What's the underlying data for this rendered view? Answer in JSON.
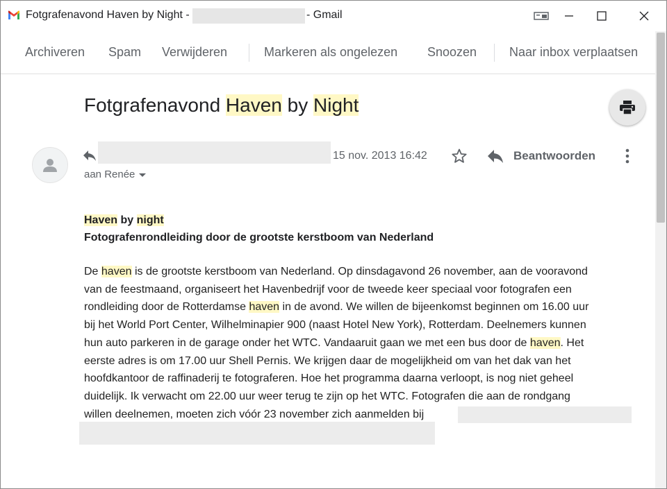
{
  "window": {
    "title_prefix": "Fotgrafenavond Haven by Night -",
    "title_suffix": "- Gmail",
    "app_icon": "gmail-icon"
  },
  "toolbar": {
    "archive": "Archiveren",
    "spam": "Spam",
    "delete": "Verwijderen",
    "mark_unread": "Markeren als ongelezen",
    "snooze": "Snoozen",
    "move_inbox": "Naar inbox verplaatsen"
  },
  "message": {
    "subject_parts": [
      "Fotgrafenavond ",
      "Haven",
      " by ",
      "Night"
    ],
    "date": "15 nov. 2013 16:42",
    "reply_label": "Beantwoorden",
    "recipient": "aan Renée",
    "heading_line1_parts": [
      "Haven",
      " by ",
      "night"
    ],
    "heading_line2": "Fotografenrondleiding door de grootste kerstboom van Nederland",
    "body_lines": [
      [
        "De ",
        "haven",
        " is de grootste kerstboom van Nederland. Op dinsdagavond 26 november, aan de vooravond"
      ],
      [
        "van de feestmaand, organiseert het Havenbedrijf voor de tweede keer speciaal voor fotografen een"
      ],
      [
        "rondleiding door de Rotterdamse ",
        "haven",
        " in de avond. We willen de bijeenkomst beginnen om 16.00 uur"
      ],
      [
        "bij het World Port Center, Wilhelminapier 900 (naast Hotel New York), Rotterdam. Deelnemers kunnen"
      ],
      [
        "hun auto parkeren in de garage onder het WTC. Vandaaruit gaan we met een bus door de ",
        "haven",
        ". Het"
      ],
      [
        "eerste adres is om 17.00 uur Shell Pernis. We krijgen daar de mogelijkheid om van het dak van het"
      ],
      [
        "hoofdkantoor de raffinaderij te fotograferen. Hoe het programma daarna verloopt, is nog niet geheel"
      ],
      [
        "duidelijk. Ik verwacht om 22.00 uur weer terug te zijn op het WTC. Fotografen die aan de rondgang"
      ],
      [
        "willen deelnemen, moeten zich vóór 23 november zich aanmelden bij"
      ]
    ]
  },
  "colors": {
    "highlight": "#fff8c5",
    "gmail_red": "#ea4335",
    "gmail_blue": "#4285f4",
    "gmail_green": "#34a853",
    "gmail_yellow": "#fbbc04"
  }
}
